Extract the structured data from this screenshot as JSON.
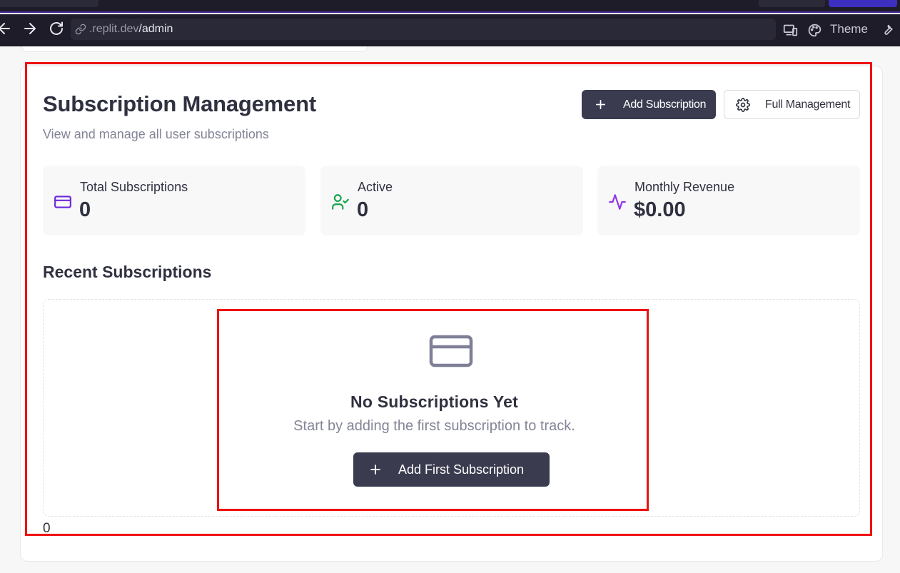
{
  "browser": {
    "url_prefix": ".replit.dev",
    "url_path": "/admin",
    "theme_label": "Theme",
    "icons": [
      "back-arrow-icon",
      "forward-arrow-icon",
      "reload-icon",
      "link-icon",
      "responsive-devices-icon",
      "palette-icon",
      "wrench-icon"
    ]
  },
  "header": {
    "title": "Subscription Management",
    "subtitle": "View and manage all user subscriptions",
    "add_button": "Add Subscription",
    "manage_button": "Full Management"
  },
  "stats": [
    {
      "label": "Total Subscriptions",
      "value": "0",
      "icon": "credit-card-icon",
      "color": "#6d28d9"
    },
    {
      "label": "Active",
      "value": "0",
      "icon": "user-check-icon",
      "color": "#16a34a"
    },
    {
      "label": "Monthly Revenue",
      "value": "$0.00",
      "icon": "activity-icon",
      "color": "#9333ea"
    }
  ],
  "recent": {
    "heading": "Recent Subscriptions",
    "empty_title": "No Subscriptions Yet",
    "empty_text": "Start by adding the first subscription to track.",
    "empty_button": "Add First Subscription"
  },
  "footer_value": "0",
  "colors": {
    "primary_button": "#3a3b4f",
    "highlight": "#ee1111",
    "muted_text": "#838597"
  }
}
